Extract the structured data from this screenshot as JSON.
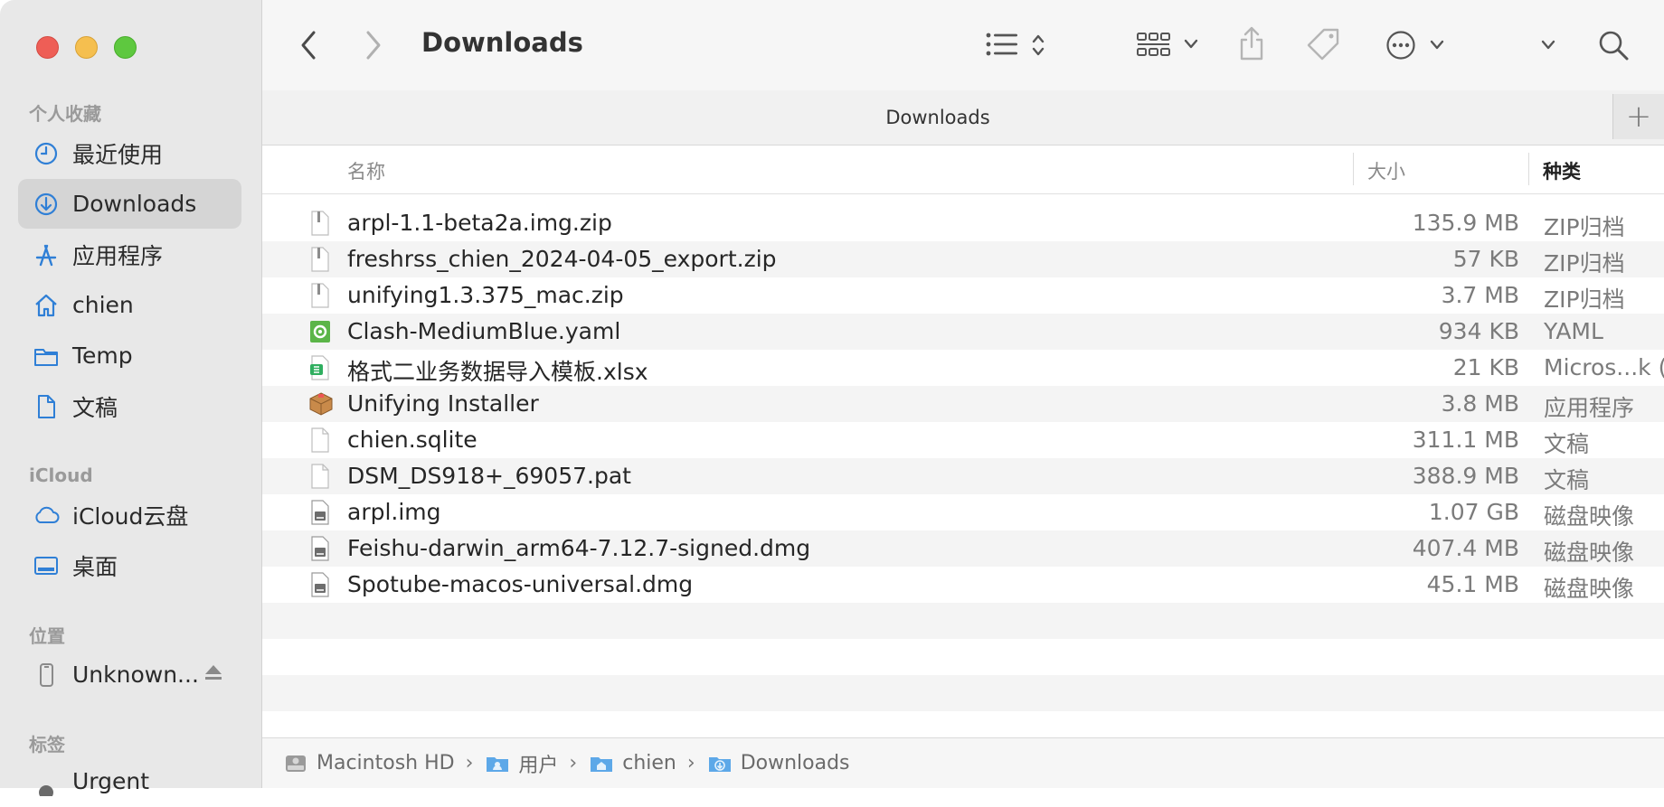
{
  "sidebar": {
    "sections": {
      "favorites": "个人收藏",
      "icloud": "iCloud",
      "locations": "位置",
      "tags": "标签"
    },
    "items": [
      {
        "label": "最近使用",
        "icon": "clock-icon"
      },
      {
        "label": "Downloads",
        "icon": "download-icon",
        "selected": true
      },
      {
        "label": "应用程序",
        "icon": "applications-icon"
      },
      {
        "label": "chien",
        "icon": "home-icon"
      },
      {
        "label": "Temp",
        "icon": "folder-icon"
      },
      {
        "label": "文稿",
        "icon": "document-icon"
      },
      {
        "label": "iCloud云盘",
        "icon": "cloud-icon"
      },
      {
        "label": "桌面",
        "icon": "desktop-icon"
      },
      {
        "label": "Unknown...",
        "icon": "phone-icon"
      },
      {
        "label": "Urgent",
        "icon": "tag-dot-icon"
      }
    ]
  },
  "window": {
    "title": "Downloads",
    "tab_label": "Downloads",
    "tab_add": "+"
  },
  "columns": {
    "name": "名称",
    "size": "大小",
    "kind": "种类"
  },
  "files": [
    {
      "name": "arpl-1.1-beta2a.img.zip",
      "size": "135.9 MB",
      "kind": "ZIP归档",
      "icon": "zip-file-icon"
    },
    {
      "name": "freshrss_chien_2024-04-05_export.zip",
      "size": "57 KB",
      "kind": "ZIP归档",
      "icon": "zip-file-icon"
    },
    {
      "name": "unifying1.3.375_mac.zip",
      "size": "3.7 MB",
      "kind": "ZIP归档",
      "icon": "zip-file-icon"
    },
    {
      "name": "Clash-MediumBlue.yaml",
      "size": "934 KB",
      "kind": "YAML",
      "icon": "yaml-file-icon"
    },
    {
      "name": "格式二业务数据导入模板.xlsx",
      "size": "21 KB",
      "kind": "Micros...k (",
      "icon": "spreadsheet-file-icon"
    },
    {
      "name": "Unifying Installer",
      "size": "3.8 MB",
      "kind": "应用程序",
      "icon": "installer-package-icon"
    },
    {
      "name": "chien.sqlite",
      "size": "311.1 MB",
      "kind": "文稿",
      "icon": "blank-file-icon"
    },
    {
      "name": "DSM_DS918+_69057.pat",
      "size": "388.9 MB",
      "kind": "文稿",
      "icon": "blank-file-icon"
    },
    {
      "name": "arpl.img",
      "size": "1.07 GB",
      "kind": "磁盘映像",
      "icon": "disk-image-icon"
    },
    {
      "name": "Feishu-darwin_arm64-7.12.7-signed.dmg",
      "size": "407.4 MB",
      "kind": "磁盘映像",
      "icon": "disk-image-icon"
    },
    {
      "name": "Spotube-macos-universal.dmg",
      "size": "45.1 MB",
      "kind": "磁盘映像",
      "icon": "disk-image-icon"
    }
  ],
  "pathbar": [
    {
      "label": "Macintosh HD",
      "icon": "hard-drive-icon"
    },
    {
      "label": "用户",
      "icon": "folder-icon"
    },
    {
      "label": "chien",
      "icon": "home-folder-icon"
    },
    {
      "label": "Downloads",
      "icon": "downloads-folder-icon"
    }
  ],
  "colors": {
    "sidebar_bg": "#e8e8e8",
    "selected_bg": "#d5d5d5",
    "accent_blue": "#2f7fd6",
    "toolbar_bg": "#f6f6f6"
  }
}
